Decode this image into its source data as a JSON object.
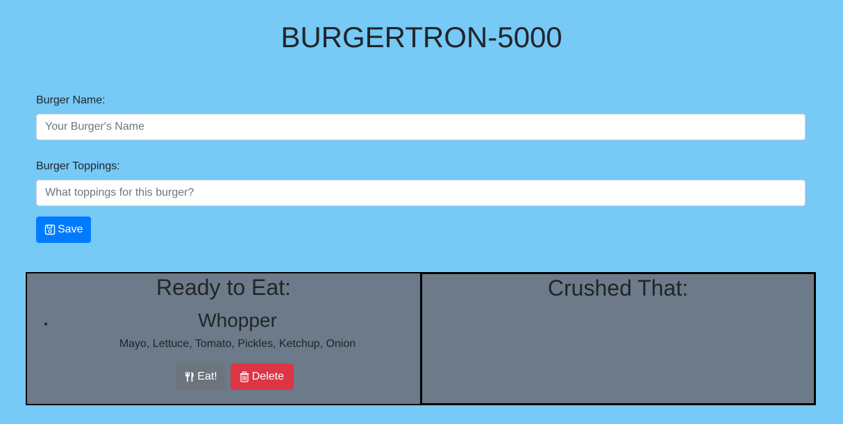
{
  "page": {
    "title": "BURGERTRON-5000"
  },
  "form": {
    "name_label": "Burger Name:",
    "name_placeholder": "Your Burger's Name",
    "name_value": "",
    "toppings_label": "Burger Toppings:",
    "toppings_placeholder": "What toppings for this burger?",
    "toppings_value": "",
    "save_label": "Save",
    "save_icon": "save-icon"
  },
  "ready": {
    "heading": "Ready to Eat:",
    "burgers": [
      {
        "name": "Whopper",
        "toppings": "Mayo, Lettuce, Tomato, Pickles, Ketchup, Onion",
        "eat_label": "Eat!",
        "eat_icon": "utensils-icon",
        "delete_label": "Delete",
        "delete_icon": "trash-icon"
      }
    ]
  },
  "crushed": {
    "heading": "Crushed That:",
    "burgers": []
  },
  "colors": {
    "background": "#77c9f6",
    "panel": "#6c7a89",
    "save_button": "#007bff",
    "eat_button": "#6c757d",
    "delete_button": "#dc3545"
  }
}
